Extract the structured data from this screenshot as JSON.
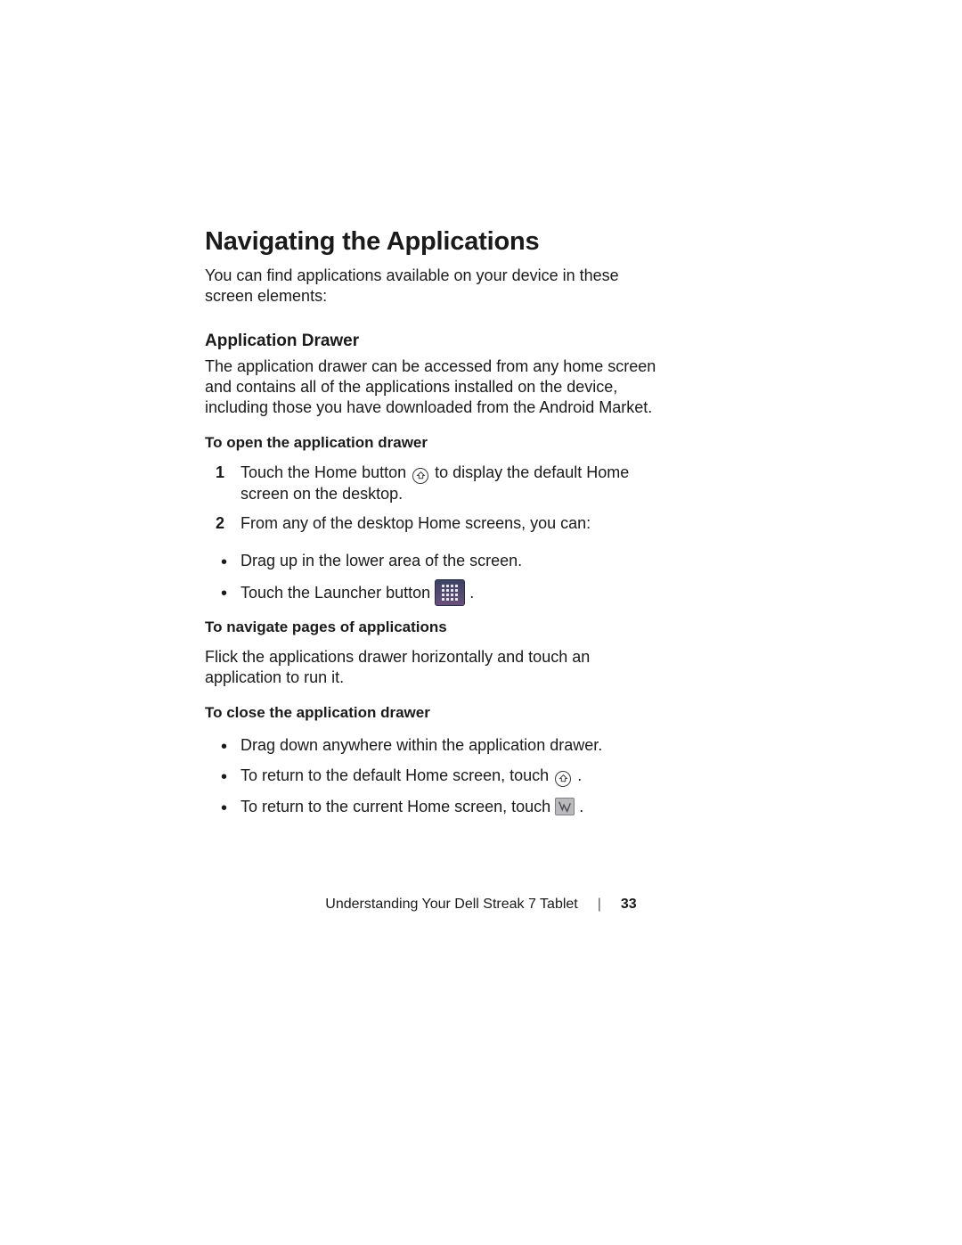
{
  "heading": "Navigating the Applications",
  "intro": "You can find applications available on your device in these screen elements:",
  "section": {
    "title": "Application Drawer",
    "desc": "The application drawer can be accessed from any home screen and contains all of the applications installed on the device, including those you have downloaded from the Android Market.",
    "open": {
      "title": "To open the application drawer",
      "steps": {
        "s1a": "Touch the Home button ",
        "s1b": " to display the default Home screen on the desktop.",
        "s2": "From any of the desktop Home screens, you can:"
      },
      "bullets": {
        "b1": "Drag up in the lower area of the screen.",
        "b2a": "Touch the Launcher button ",
        "b2b": "."
      }
    },
    "navigate": {
      "title": "To navigate pages of applications",
      "desc": "Flick the applications drawer horizontally and touch an application to run it."
    },
    "close": {
      "title": "To close the application drawer",
      "bullets": {
        "b1": "Drag down anywhere within the application drawer.",
        "b2a": "To return to the default Home screen, touch ",
        "b2b": " .",
        "b3a": "To return to the current Home screen, touch ",
        "b3b": "."
      }
    }
  },
  "footer": {
    "title": "Understanding Your Dell Streak 7 Tablet",
    "page": "33"
  }
}
